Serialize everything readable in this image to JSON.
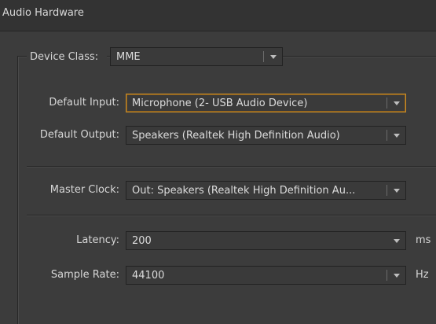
{
  "window": {
    "title": "Audio Hardware"
  },
  "device_class": {
    "label": "Device Class:",
    "value": "MME"
  },
  "default_input": {
    "label": "Default Input:",
    "value": "Microphone (2- USB Audio Device)"
  },
  "default_output": {
    "label": "Default Output:",
    "value": "Speakers (Realtek High Definition Audio)"
  },
  "master_clock": {
    "label": "Master Clock:",
    "value": "Out: Speakers (Realtek High Definition Au..."
  },
  "latency": {
    "label": "Latency:",
    "value": "200",
    "unit": "ms"
  },
  "sample_rate": {
    "label": "Sample Rate:",
    "value": "44100",
    "unit": "Hz"
  },
  "colors": {
    "focus_border": "#c78c2c",
    "background": "#3c3c3c"
  }
}
